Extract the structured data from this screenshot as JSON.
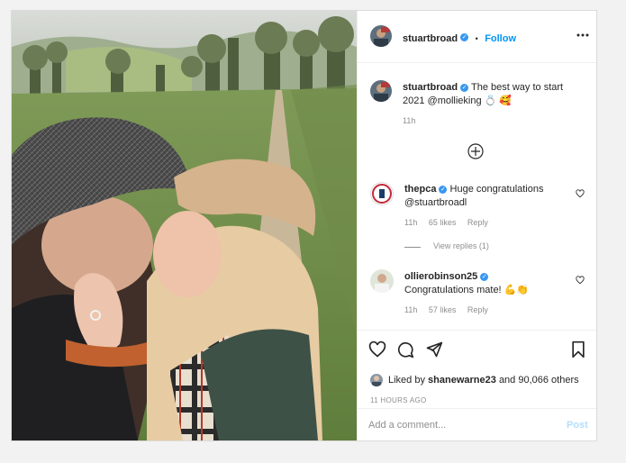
{
  "post": {
    "username": "stuartbroad",
    "dot": "•",
    "follow_label": "Follow",
    "more_icon": "ellipsis-icon"
  },
  "caption": {
    "username": "stuartbroad",
    "text": "The best way to start 2021 @mollieking 💍 🥰",
    "time": "11h"
  },
  "comments": [
    {
      "username": "thepca",
      "text": "Huge congratulations @stuartbroadl",
      "time": "11h",
      "likes": "65 likes",
      "reply_label": "Reply",
      "view_replies": "View replies (1)"
    },
    {
      "username": "ollierobinson25",
      "text": "Congratulations mate! 💪👏",
      "time": "11h",
      "likes": "57 likes",
      "reply_label": "Reply"
    }
  ],
  "likes": {
    "prefix": "Liked by",
    "user": "shanewarne23",
    "suffix": "and 90,066 others"
  },
  "timestamp": "11 HOURS AGO",
  "comment_box": {
    "placeholder": "Add a comment...",
    "post_label": "Post"
  },
  "colors": {
    "accent": "#0095f6",
    "verified": "#3897f0",
    "muted": "#8e8e8e",
    "post_disabled": "#b2dffc"
  }
}
